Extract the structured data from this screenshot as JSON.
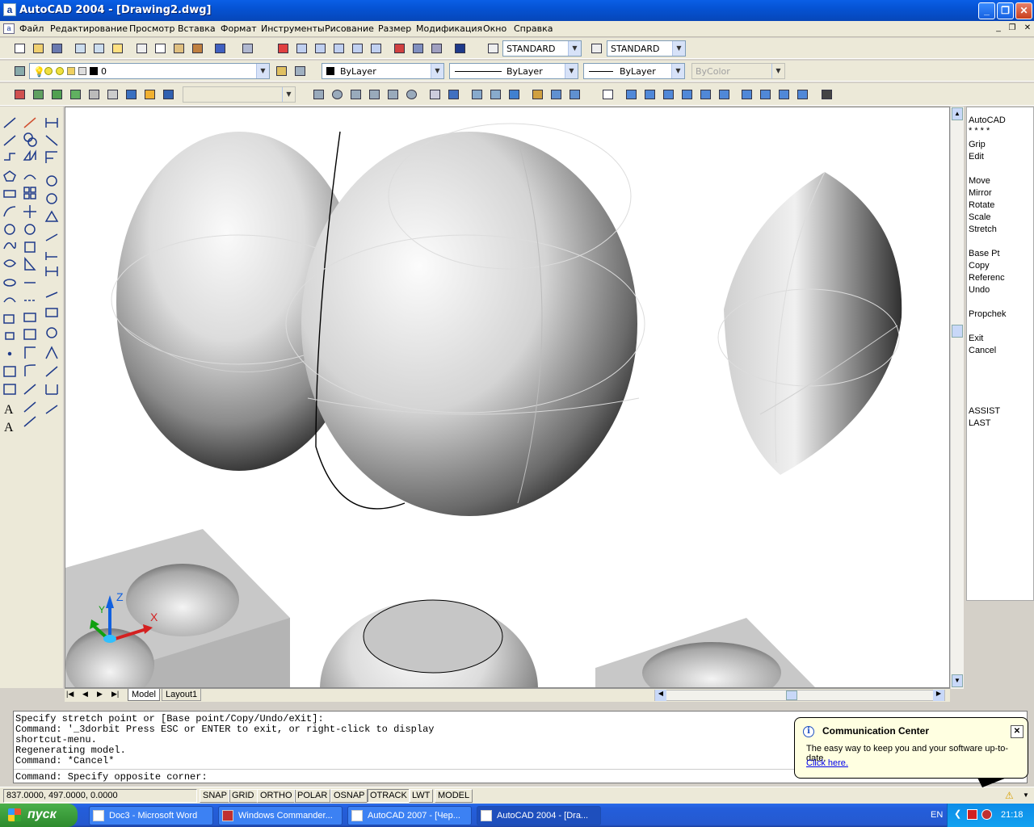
{
  "window": {
    "title": "AutoCAD 2004 - [Drawing2.dwg]",
    "minimize_glyph": "_",
    "restore_glyph": "❐",
    "close_glyph": "✕",
    "app_icon": "a"
  },
  "menu": {
    "items": [
      "Файл",
      "Редактирование",
      "Просмотр",
      "Вставка",
      "Формат",
      "Инструменты",
      "Рисование",
      "Размер",
      "Модификация",
      "Окно",
      "Справка"
    ],
    "mdi_min": "_",
    "mdi_restore": "❐",
    "mdi_close": "✕"
  },
  "toolbar": {
    "text_style": "STANDARD",
    "dim_style": "STANDARD",
    "layer": "0",
    "color": "ByLayer",
    "linetype": "ByLayer",
    "lineweight": "ByLayer",
    "plot_style": "ByColor"
  },
  "right_menu": {
    "items": [
      "AutoCAD",
      "* * * *",
      "Grip",
      "Edit",
      "",
      "Move",
      "Mirror",
      "Rotate",
      "Scale",
      "Stretch",
      "",
      "Base Pt",
      "Copy",
      "Referenc",
      "Undo",
      "",
      "Propchek",
      "",
      "Exit",
      "Cancel",
      "",
      "",
      "",
      "",
      "ASSIST",
      "LAST"
    ]
  },
  "tabs": {
    "model": "Model",
    "layout1": "Layout1"
  },
  "ucs": {
    "x_label": "X",
    "y_label": "Y",
    "z_label": "Z"
  },
  "command_window": {
    "lines": [
      "Specify stretch point or [Base point/Copy/Undo/eXit]:",
      "Command: '_3dorbit Press ESC or ENTER to exit, or right-click to display",
      "shortcut-menu.",
      "Regenerating model.",
      "Command: *Cancel*"
    ],
    "prompt": "Command: Specify opposite corner:"
  },
  "statusbar": {
    "coords": "837.0000, 497.0000, 0.0000",
    "buttons": [
      "SNAP",
      "GRID",
      "ORTHO",
      "POLAR",
      "OSNAP",
      "OTRACK",
      "LWT",
      "MODEL"
    ]
  },
  "balloon": {
    "title": "Communication Center",
    "body": "The easy way to keep you and your software up-to-date.",
    "link": "Click here.",
    "info_glyph": "i",
    "close_glyph": "✕"
  },
  "taskbar": {
    "start": "пуск",
    "tasks": [
      "Doc3 - Microsoft Word",
      "Windows Commander...",
      "AutoCAD 2007 - [Чер...",
      "AutoCAD 2004 - [Dra..."
    ],
    "lang": "EN",
    "clock": "21:18"
  },
  "colors": {
    "title_blue": "#0553d4",
    "taskbar_blue": "#245edb",
    "start_green": "#2e8b2e",
    "ucs_x": "#d42020",
    "ucs_y": "#10a010",
    "ucs_z": "#1060e0"
  }
}
